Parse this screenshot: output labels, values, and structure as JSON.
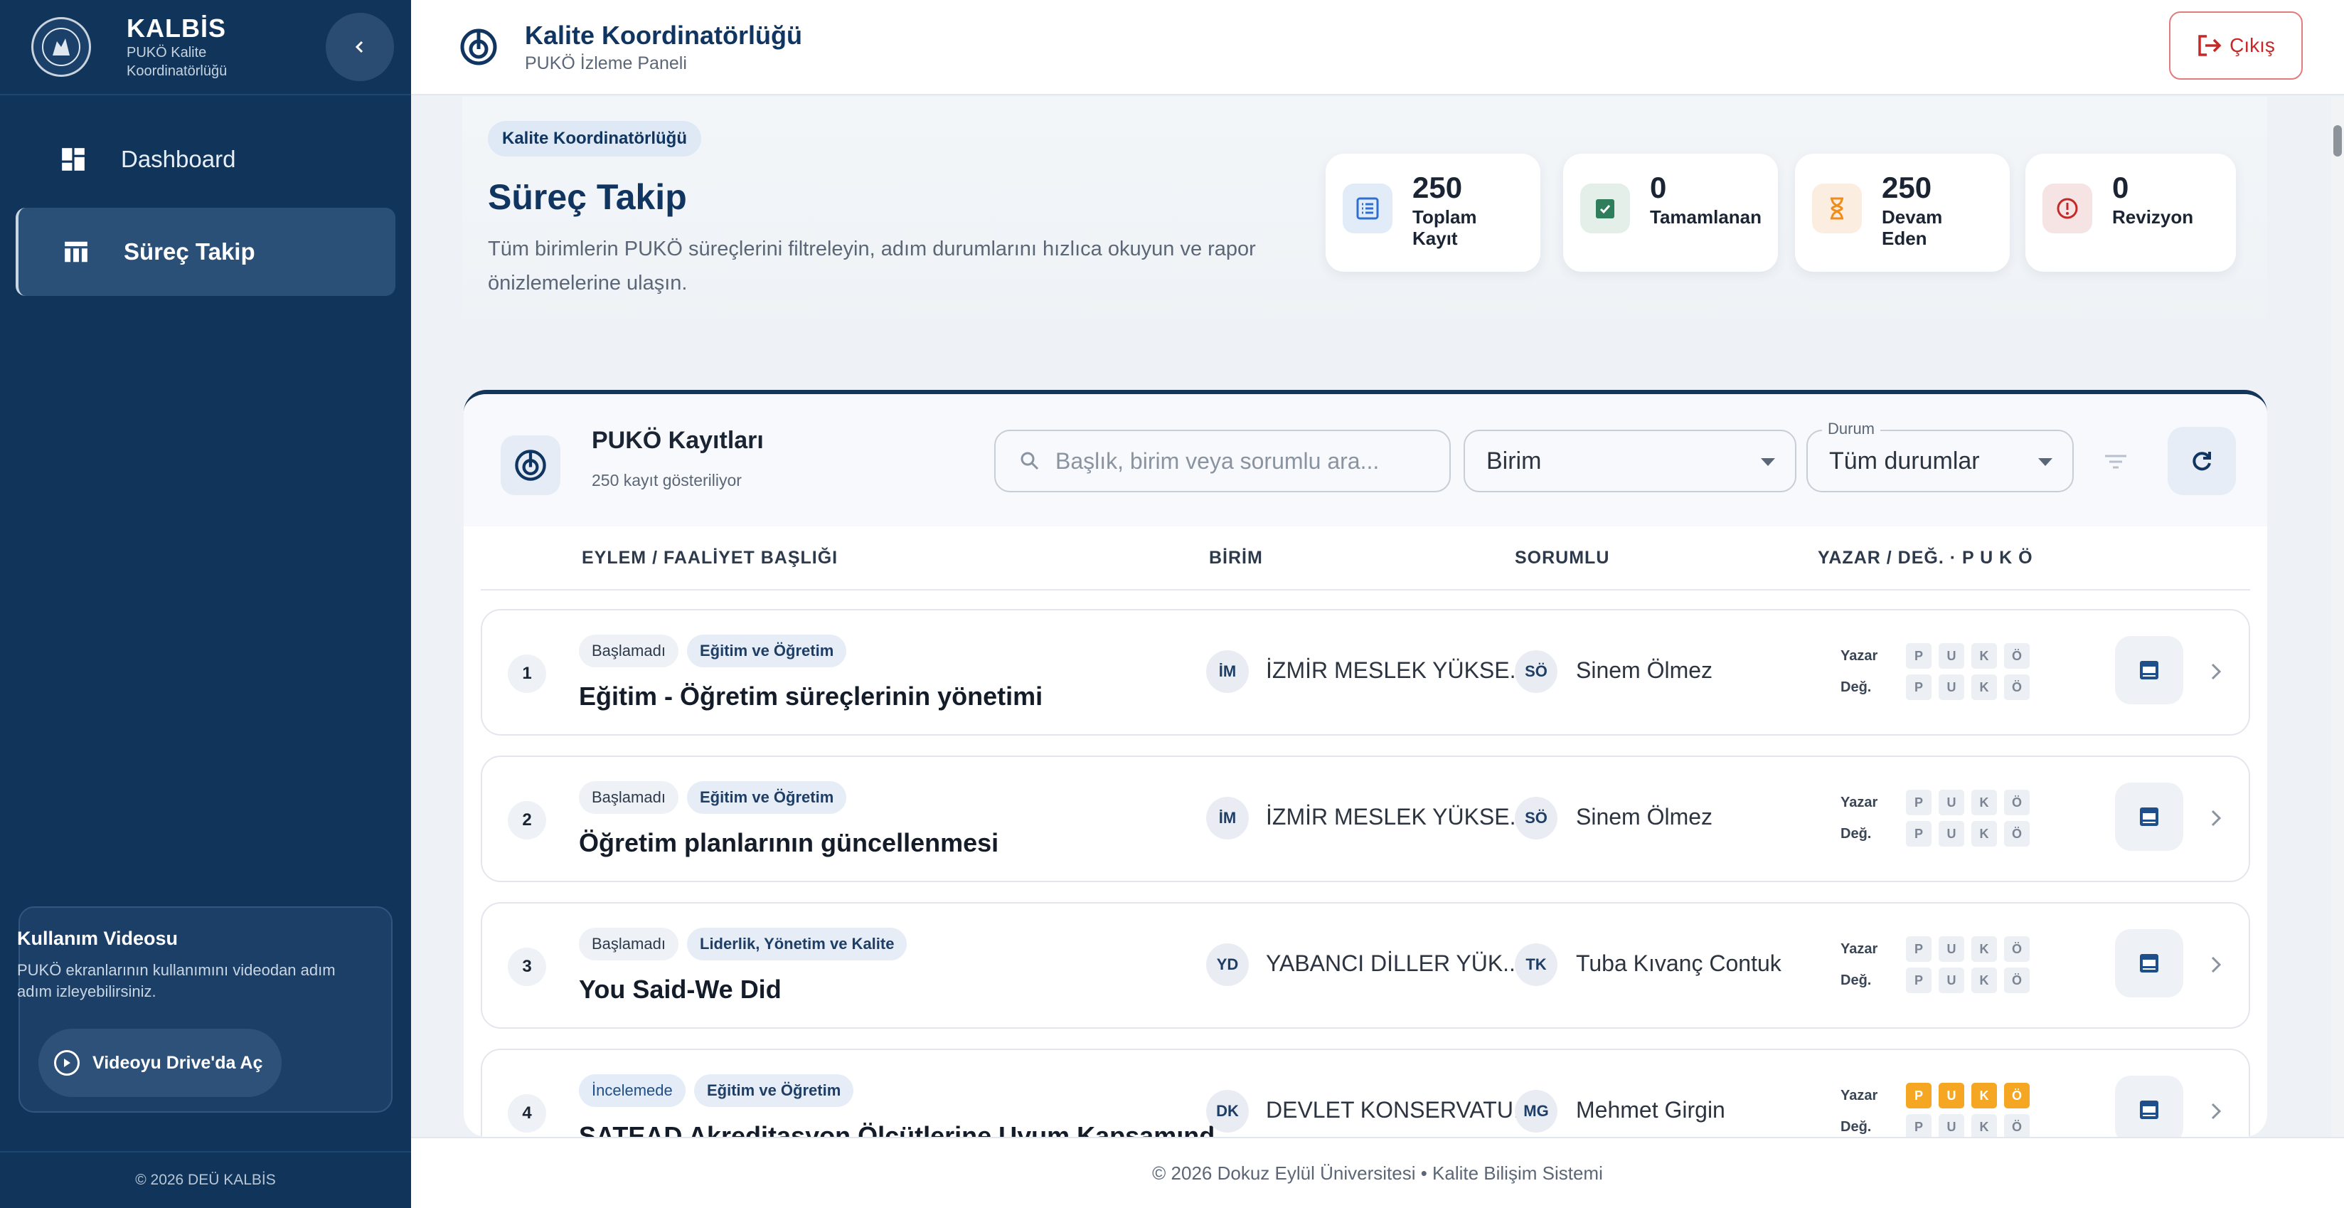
{
  "sidebar": {
    "brand_title": "KALBİS",
    "brand_sub": "PUKÖ Kalite Koordinatörlüğü",
    "nav": [
      {
        "label": "Dashboard",
        "icon": "dashboard-icon"
      },
      {
        "label": "Süreç Takip",
        "icon": "table-icon",
        "active": true
      }
    ],
    "video": {
      "title": "Kullanım Videosu",
      "desc": "PUKÖ ekranlarının kullanımını videodan adım adım izleyebilirsiniz.",
      "button": "Videoyu Drive'da Aç"
    },
    "footer": "© 2026 DEÜ KALBİS"
  },
  "topbar": {
    "title": "Kalite Koordinatörlüğü",
    "subtitle": "PUKÖ İzleme Paneli",
    "logout": "Çıkış"
  },
  "hero": {
    "chip": "Kalite Koordinatörlüğü",
    "title": "Süreç Takip",
    "desc": "Tüm birimlerin PUKÖ süreçlerini filtreleyin, adım durumlarını hızlıca okuyun ve rapor önizlemelerine ulaşın.",
    "stats": [
      {
        "num": "250",
        "label": "Toplam Kayıt",
        "color": "#2f6fd0"
      },
      {
        "num": "0",
        "label": "Tamamlanan",
        "color": "#2e7d5b"
      },
      {
        "num": "250",
        "label": "Devam Eden",
        "color": "#f08c1a"
      },
      {
        "num": "0",
        "label": "Revizyon",
        "color": "#c62828"
      }
    ]
  },
  "records": {
    "title": "PUKÖ Kayıtları",
    "subtitle": "250 kayıt gösteriliyor",
    "search_placeholder": "Başlık, birim veya sorumlu ara...",
    "unit_select": "Birim",
    "status_legend": "Durum",
    "status_select": "Tüm durumlar",
    "columns": [
      "EYLEM / FAALİYET BAŞLIĞI",
      "BİRİM",
      "SORUMLU",
      "YAZAR / DEĞ. · P U K Ö"
    ],
    "yazar_label": "Yazar",
    "deg_label": "Değ.",
    "puko_letters": [
      "P",
      "U",
      "K",
      "Ö"
    ],
    "rows": [
      {
        "num": "1",
        "status": "Başlamadı",
        "category": "Eğitim ve Öğretim",
        "title": "Eğitim - Öğretim süreçlerinin yönetimi",
        "unit_abbr": "İM",
        "unit": "İZMİR MESLEK YÜKSE...",
        "person_abbr": "SÖ",
        "person": "Sinem Ölmez",
        "yazar_on": false
      },
      {
        "num": "2",
        "status": "Başlamadı",
        "category": "Eğitim ve Öğretim",
        "title": "Öğretim planlarının güncellenmesi",
        "unit_abbr": "İM",
        "unit": "İZMİR MESLEK YÜKSE...",
        "person_abbr": "SÖ",
        "person": "Sinem Ölmez",
        "yazar_on": false
      },
      {
        "num": "3",
        "status": "Başlamadı",
        "category": "Liderlik, Yönetim ve Kalite",
        "title": "You Said-We Did",
        "unit_abbr": "YD",
        "unit": "YABANCI DİLLER YÜK...",
        "person_abbr": "TK",
        "person": "Tuba Kıvanç Contuk",
        "yazar_on": false
      },
      {
        "num": "4",
        "status": "İncelemede",
        "category": "Eğitim ve Öğretim",
        "title": "SATEAD Akreditasyon Ölçütlerine Uyum Kapsamınd...",
        "unit_abbr": "DK",
        "unit": "DEVLET KONSERVATU...",
        "person_abbr": "MG",
        "person": "Mehmet Girgin",
        "yazar_on": true
      }
    ]
  },
  "footer": "© 2026 Dokuz Eylül Üniversitesi • Kalite Bilişim Sistemi",
  "colors": {
    "sidebar": "#11355a",
    "accent": "#0f3560",
    "logout": "#c62828",
    "puko_on": "#f5a623"
  }
}
